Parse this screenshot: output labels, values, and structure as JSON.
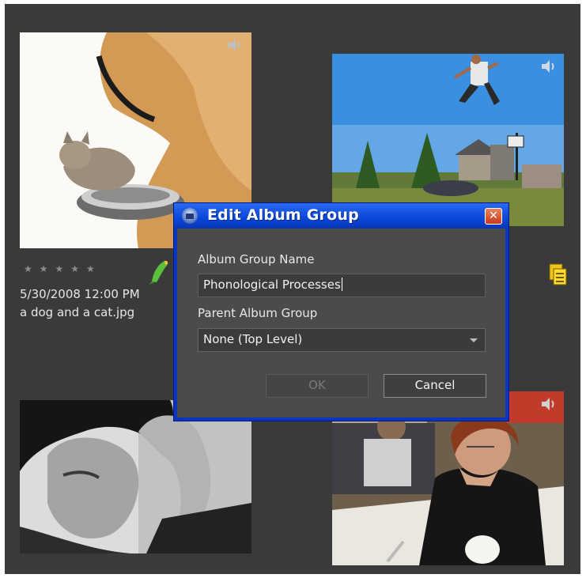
{
  "photo_grid": {
    "photos": [
      {
        "rating_stars": "★★★★★",
        "date": "5/30/2008 12:00 PM",
        "filename": "a dog and a cat.jpg"
      }
    ]
  },
  "dialog": {
    "title": "Edit Album Group",
    "close_glyph": "✕",
    "album_group_name_label": "Album Group Name",
    "album_group_name_value": "Phonological Processes",
    "parent_album_group_label": "Parent Album Group",
    "parent_album_group_selected": "None (Top Level)",
    "ok_label": "OK",
    "cancel_label": "Cancel"
  },
  "icons": {
    "audio": "speaker-icon",
    "parrot": "parrot-icon",
    "clip": "clip-icon",
    "dialog": "camera-icon",
    "close": "close-icon",
    "dropdown": "chevron-down-icon"
  },
  "colors": {
    "background": "#3a3a3a",
    "dialog_frame": "#0a35c0",
    "dialog_body": "#4b4b4b",
    "close_button": "#d1481f"
  }
}
